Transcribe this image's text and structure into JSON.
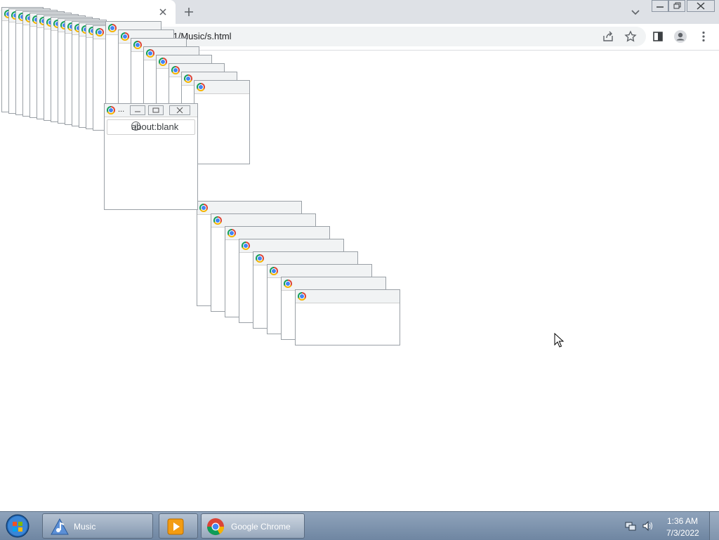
{
  "browser": {
    "address_url": "C:/Users/vm1/Music/s.html",
    "popup_address": "about:blank",
    "popup_title_ellipsis": "..."
  },
  "taskbar": {
    "buttons": [
      {
        "label": "Music"
      },
      {
        "label": ""
      },
      {
        "label": "Google Chrome"
      }
    ],
    "clock": {
      "time": "1:36 AM",
      "date": "7/3/2022"
    }
  }
}
